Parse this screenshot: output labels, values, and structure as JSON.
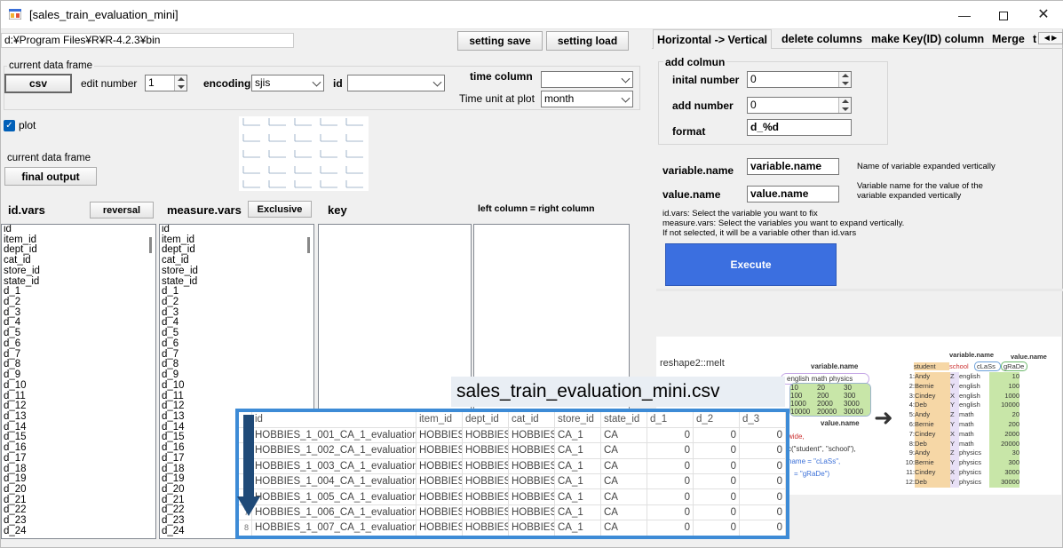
{
  "window": {
    "title": "[sales_train_evaluation_mini]"
  },
  "path": {
    "value": "d:¥Program Files¥R¥R-4.2.3¥bin"
  },
  "toolbar": {
    "setting_save": "setting save",
    "setting_load": "setting load"
  },
  "data_frame": {
    "group_label": "current data frame",
    "csv_button": "csv",
    "edit_number_label": "edit number",
    "edit_number_value": "1",
    "encoding_label": "encoding",
    "encoding_value": "sjis",
    "id_label": "id",
    "id_value": "",
    "time_column_label": "time column",
    "time_column_value": "",
    "time_unit_label": "Time unit at plot",
    "time_unit_value": "month"
  },
  "plot": {
    "checked": true,
    "label": "plot"
  },
  "output": {
    "label": "current data frame",
    "final_output_button": "final output"
  },
  "columns": {
    "id_vars_label": "id.vars",
    "reversal_button": "reversal",
    "measure_vars_label": "measure.vars",
    "exclusive_button": "Exclusive",
    "key_label": "key",
    "lr_label": "left column = right  column"
  },
  "vars_list": [
    "id",
    "item_id",
    "dept_id",
    "cat_id",
    "store_id",
    "state_id",
    "d_1",
    "d_2",
    "d_3",
    "d_4",
    "d_5",
    "d_6",
    "d_7",
    "d_8",
    "d_9",
    "d_10",
    "d_11",
    "d_12",
    "d_13",
    "d_14",
    "d_15",
    "d_16",
    "d_17",
    "d_18",
    "d_19",
    "d_20",
    "d_21",
    "d_22",
    "d_23",
    "d_24"
  ],
  "tabs": [
    "Horizontal -> Vertical",
    "delete columns",
    "make Key(ID) column",
    "Merge",
    "t"
  ],
  "add_column": {
    "group_label": "add colmun",
    "initial_number_label": "inital number",
    "initial_number_value": "0",
    "add_number_label": "add number",
    "add_number_value": "0",
    "format_label": "format",
    "format_value": "d_%d"
  },
  "naming": {
    "variable_name_label": "variable.name",
    "variable_name_value": "variable.name",
    "variable_name_hint": "Name of variable expanded vertically",
    "value_name_label": "value.name",
    "value_name_value": "value.name",
    "value_name_hint": "Variable name for the value of the variable expanded vertically",
    "help_line1": "id.vars: Select the variable you want to fix",
    "help_line2": "measure.vars: Select the variables you want to expand vertically.",
    "help_line3": "If not selected, it will be a variable other than id.vars"
  },
  "execute_button": "Execute",
  "illustration": {
    "caption": "reshape2::melt",
    "hdr_variable_name": "variable.name",
    "hdr_value_name": "value.name",
    "hdr_value_name2": "value.name",
    "wide_header": "english  math physics",
    "wide_rows": [
      [
        "10",
        "20",
        "30"
      ],
      [
        "100",
        "200",
        "300"
      ],
      [
        "1000",
        "2000",
        "3000"
      ],
      [
        "10000",
        "20000",
        "30000"
      ]
    ],
    "code1": "wide,",
    "code2": "c(\"student\", \"school\"),",
    "code3": "name = \"cLaSs\",",
    "code4": "= \"gRaDe\")",
    "long_header": [
      "student",
      "school",
      "cLaSs",
      "gRaDe"
    ],
    "long_rows": [
      [
        "1:",
        "Andy",
        "Z",
        "english",
        "10"
      ],
      [
        "2:",
        "Bernie",
        "Y",
        "english",
        "100"
      ],
      [
        "3:",
        "Cindey",
        "X",
        "english",
        "1000"
      ],
      [
        "4:",
        "Deb",
        "Y",
        "english",
        "10000"
      ],
      [
        "5:",
        "Andy",
        "Z",
        "math",
        "20"
      ],
      [
        "6:",
        "Bernie",
        "Y",
        "math",
        "200"
      ],
      [
        "7:",
        "Cindey",
        "X",
        "math",
        "2000"
      ],
      [
        "8:",
        "Deb",
        "Y",
        "math",
        "20000"
      ],
      [
        "9:",
        "Andy",
        "Z",
        "physics",
        "30"
      ],
      [
        "10:",
        "Bernie",
        "Y",
        "physics",
        "300"
      ],
      [
        "11:",
        "Cindey",
        "X",
        "physics",
        "3000"
      ],
      [
        "12:",
        "Deb",
        "Y",
        "physics",
        "30000"
      ]
    ]
  },
  "preview": {
    "filename": "sales_train_evaluation_mini.csv",
    "headers": [
      "id",
      "item_id",
      "dept_id",
      "cat_id",
      "store_id",
      "state_id",
      "d_1",
      "d_2",
      "d_3"
    ],
    "rows": [
      {
        "rh": "",
        "cells": [
          "HOBBIES_1_001_CA_1_evaluation",
          "HOBBIES_",
          "HOBBIES_",
          "HOBBIES",
          "CA_1",
          "CA",
          "0",
          "0",
          "0"
        ]
      },
      {
        "rh": "",
        "cells": [
          "HOBBIES_1_002_CA_1_evaluation",
          "HOBBIES_",
          "HOBBIES_",
          "HOBBIES",
          "CA_1",
          "CA",
          "0",
          "0",
          "0"
        ]
      },
      {
        "rh": "",
        "cells": [
          "HOBBIES_1_003_CA_1_evaluation",
          "HOBBIES_",
          "HOBBIES_",
          "HOBBIES",
          "CA_1",
          "CA",
          "0",
          "0",
          "0"
        ]
      },
      {
        "rh": "",
        "cells": [
          "HOBBIES_1_004_CA_1_evaluation",
          "HOBBIES_",
          "HOBBIES_",
          "HOBBIES",
          "CA_1",
          "CA",
          "0",
          "0",
          "0"
        ]
      },
      {
        "rh": "",
        "cells": [
          "HOBBIES_1_005_CA_1_evaluation",
          "HOBBIES_",
          "HOBBIES_",
          "HOBBIES",
          "CA_1",
          "CA",
          "0",
          "0",
          "0"
        ]
      },
      {
        "rh": "7",
        "cells": [
          "HOBBIES_1_006_CA_1_evaluation",
          "HOBBIES_",
          "HOBBIES_",
          "HOBBIES",
          "CA_1",
          "CA",
          "0",
          "0",
          "0"
        ]
      },
      {
        "rh": "8",
        "cells": [
          "HOBBIES_1_007_CA_1_evaluation",
          "HOBBIES_",
          "HOBBIES_",
          "HOBBIES",
          "CA_1",
          "CA",
          "0",
          "0",
          "0"
        ]
      }
    ]
  },
  "colors": {
    "execute": "#3b6fe0",
    "grid_border": "#3d8bd6",
    "checkbox": "#005fb8"
  }
}
